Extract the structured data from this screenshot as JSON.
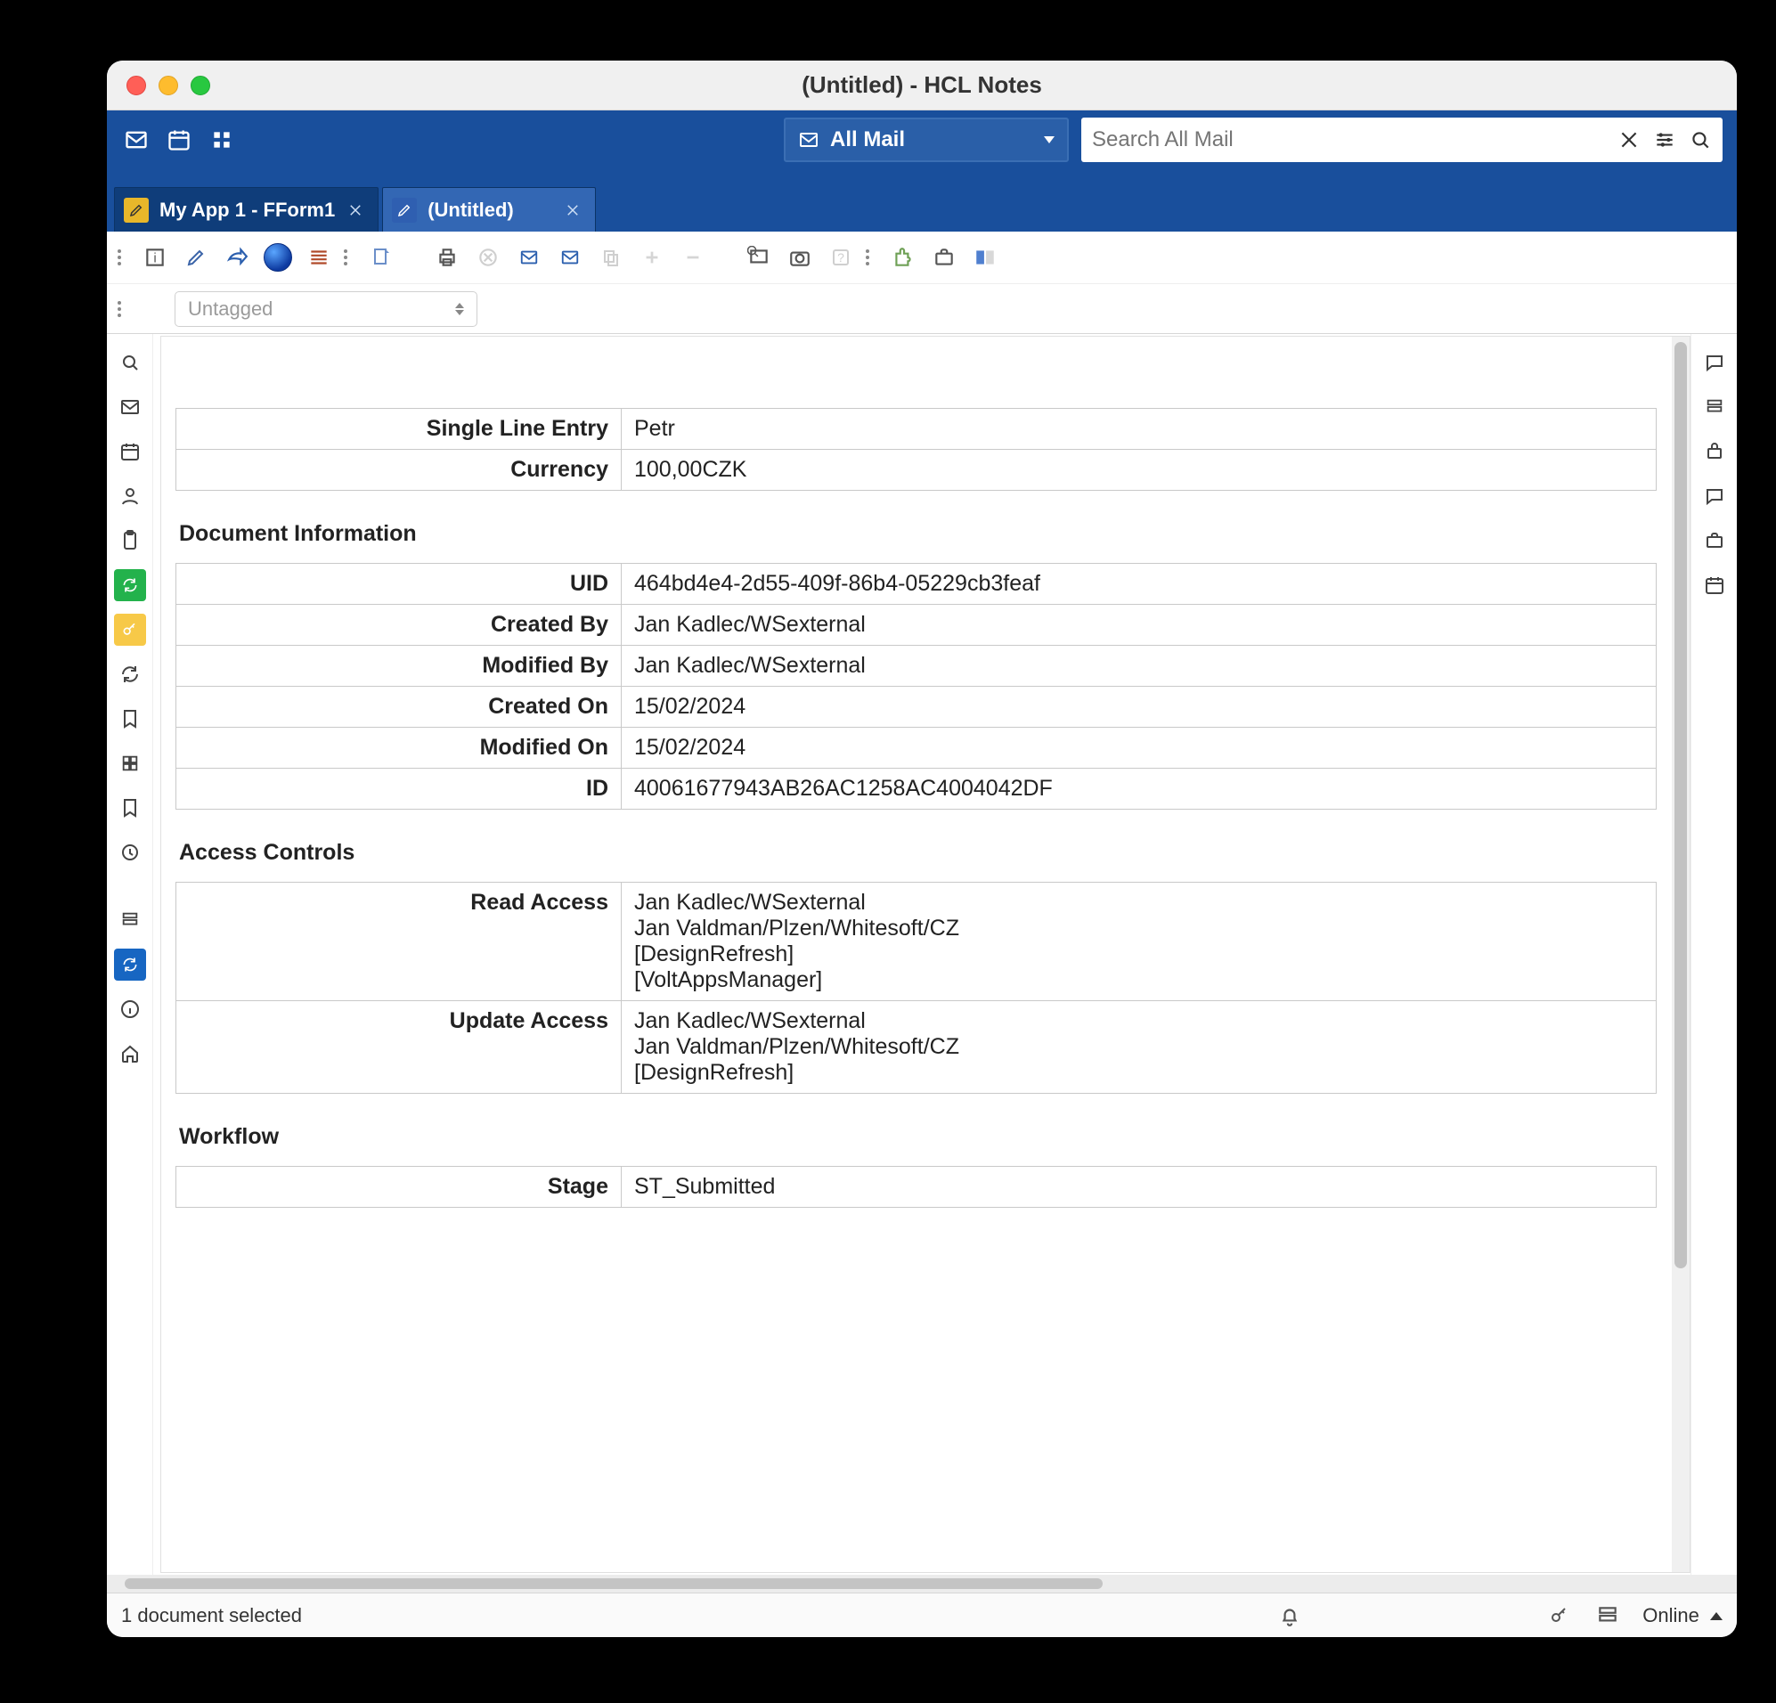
{
  "window": {
    "title": "(Untitled) - HCL Notes"
  },
  "header": {
    "mailbox_label": "All Mail",
    "search_placeholder": "Search All Mail"
  },
  "tabs": [
    {
      "label": "My App 1 - FForm1",
      "active": false
    },
    {
      "label": "(Untitled)",
      "active": true
    }
  ],
  "tag_selector": {
    "value": "Untagged"
  },
  "form": {
    "top_fields": [
      {
        "label": "Single Line Entry",
        "value": "Petr"
      },
      {
        "label": "Currency",
        "value": "100,00CZK"
      }
    ],
    "doc_info_title": "Document Information",
    "doc_info": [
      {
        "label": "UID",
        "value": "464bd4e4-2d55-409f-86b4-05229cb3feaf"
      },
      {
        "label": "Created By",
        "value": "Jan Kadlec/WSexternal"
      },
      {
        "label": "Modified By",
        "value": "Jan Kadlec/WSexternal"
      },
      {
        "label": "Created On",
        "value": "15/02/2024"
      },
      {
        "label": "Modified On",
        "value": "15/02/2024"
      },
      {
        "label": "ID",
        "value": "40061677943AB26AC1258AC4004042DF"
      }
    ],
    "access_title": "Access Controls",
    "access": [
      {
        "label": "Read Access",
        "lines": [
          "Jan Kadlec/WSexternal",
          "Jan Valdman/Plzen/Whitesoft/CZ",
          "[DesignRefresh]",
          "[VoltAppsManager]"
        ]
      },
      {
        "label": "Update Access",
        "lines": [
          "Jan Kadlec/WSexternal",
          "Jan Valdman/Plzen/Whitesoft/CZ",
          "[DesignRefresh]"
        ]
      }
    ],
    "workflow_title": "Workflow",
    "workflow": [
      {
        "label": "Stage",
        "value": "ST_Submitted"
      }
    ]
  },
  "status": {
    "left": "1 document selected",
    "online": "Online"
  }
}
